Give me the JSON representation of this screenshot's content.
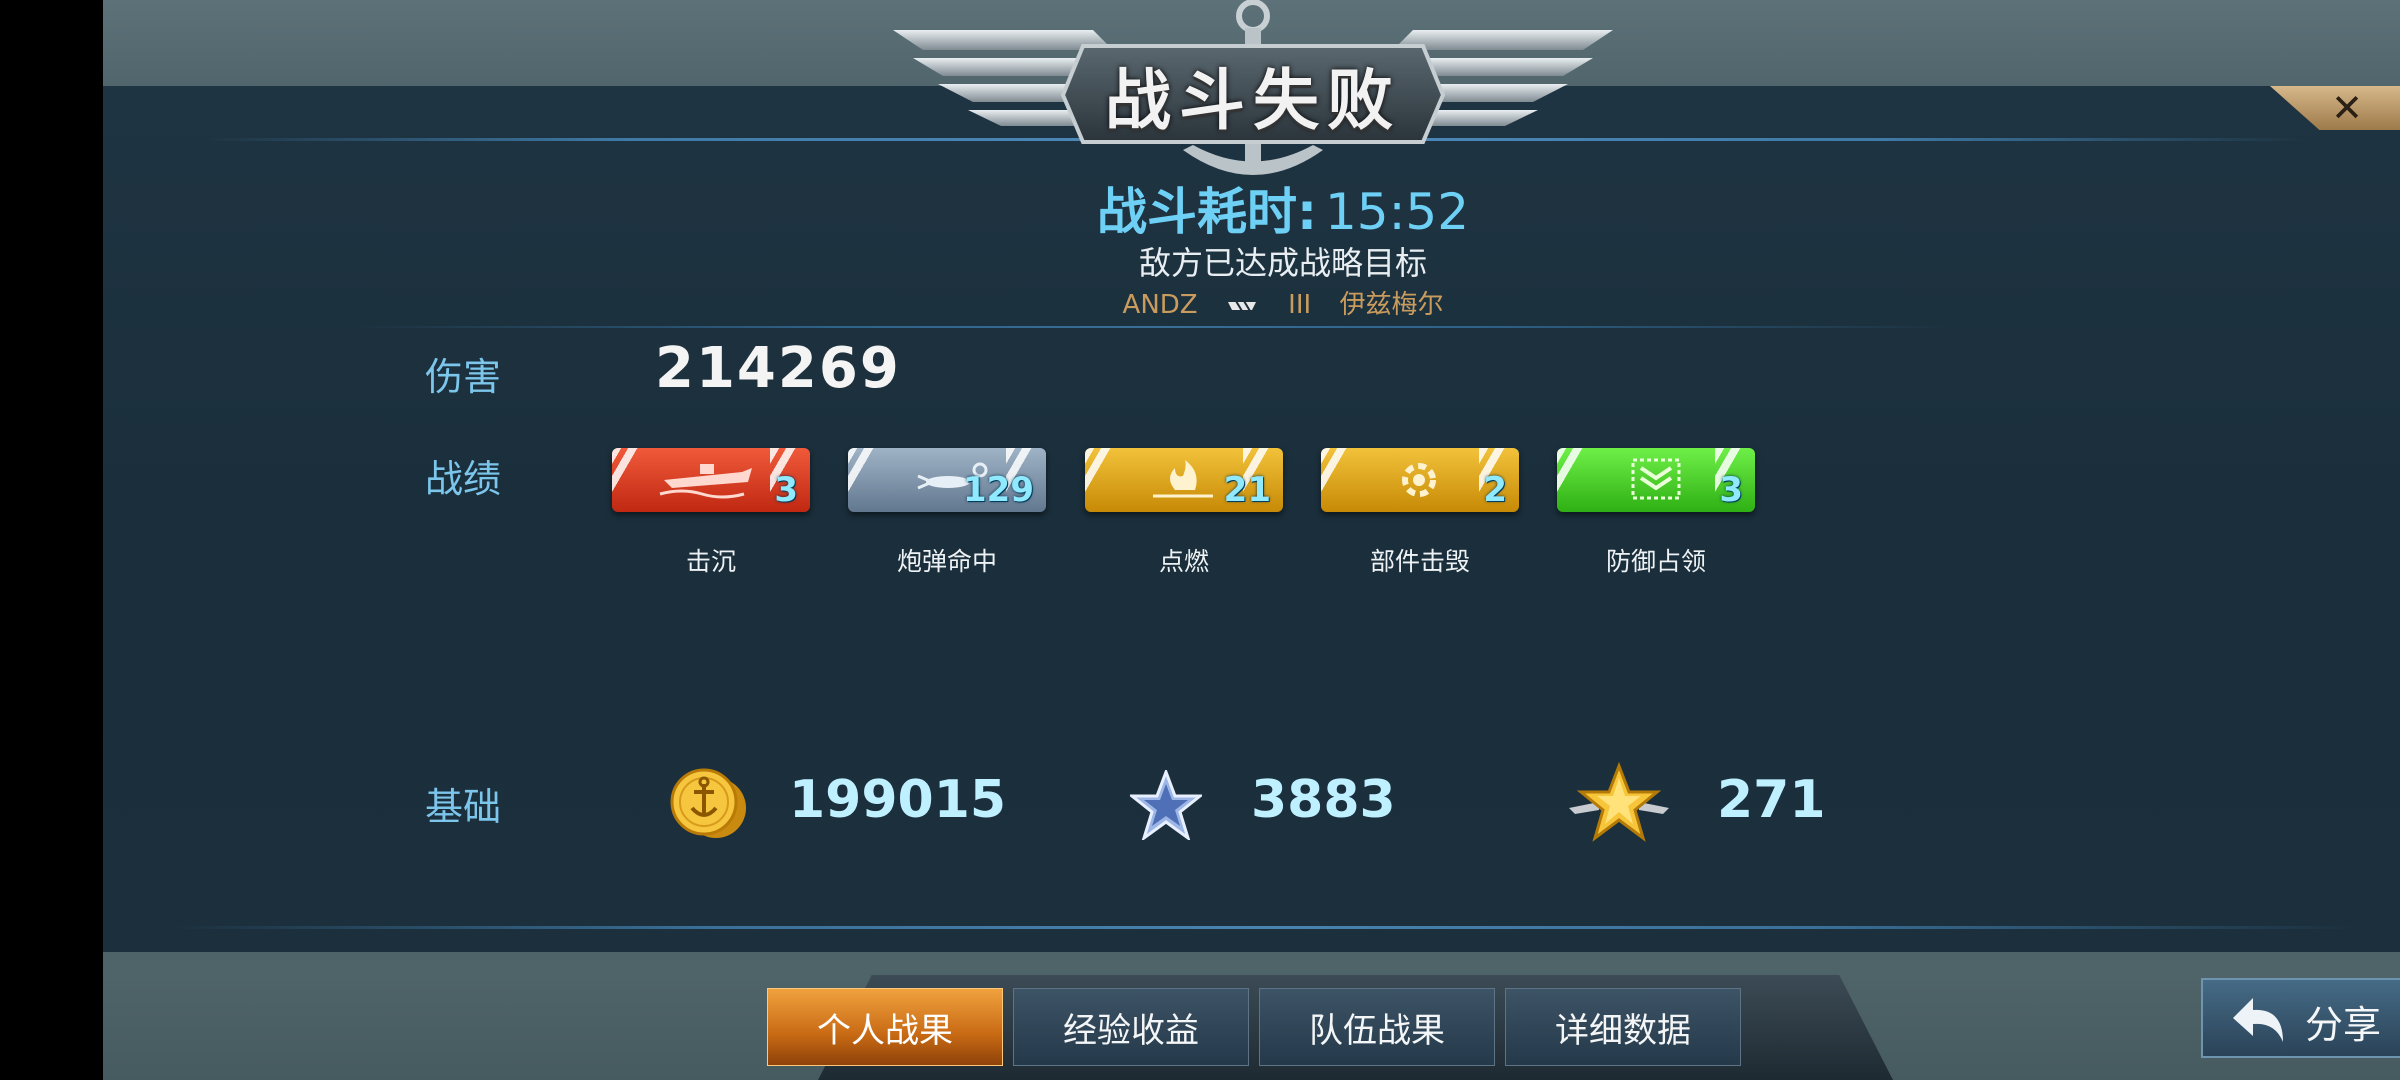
{
  "header": {
    "title": "战斗失败",
    "close_label": "✕"
  },
  "battle": {
    "time_label": "战斗耗时:",
    "time_value": "15:52",
    "result_reason": "敌方已达成战略目标",
    "player_tag": "ANDZ",
    "rank_mark": "III",
    "ship_name": "伊兹梅尔"
  },
  "damage": {
    "label": "伤害",
    "value": "214269"
  },
  "achievements": {
    "label": "战绩",
    "items": [
      {
        "icon": "sunk-ship-icon",
        "count": "3",
        "label": "击沉",
        "color": "#d83a22"
      },
      {
        "icon": "shell-hit-icon",
        "count": "129",
        "label": "炮弹命中",
        "color": "#7e94ad"
      },
      {
        "icon": "fire-icon",
        "count": "21",
        "label": "点燃",
        "color": "#e2a412"
      },
      {
        "icon": "module-destroy-icon",
        "count": "2",
        "label": "部件击毁",
        "color": "#e2a412"
      },
      {
        "icon": "defense-capture-icon",
        "count": "3",
        "label": "防御占领",
        "color": "#46d32a"
      }
    ]
  },
  "base": {
    "label": "基础",
    "coins": {
      "icon": "gold-coin-icon",
      "value": "199015"
    },
    "exp": {
      "icon": "blue-star-icon",
      "value": "3883"
    },
    "rank_points": {
      "icon": "gold-winged-star-icon",
      "value": "271"
    }
  },
  "tabs": [
    {
      "label": "个人战果",
      "active": true
    },
    {
      "label": "经验收益",
      "active": false
    },
    {
      "label": "队伍战果",
      "active": false
    },
    {
      "label": "详细数据",
      "active": false
    }
  ],
  "share": {
    "label": "分享",
    "icon": "share-arrow-icon"
  },
  "colors": {
    "accent_blue": "#6fd0f6",
    "label_blue": "#7cc6ec",
    "gold": "#c99c5e"
  }
}
